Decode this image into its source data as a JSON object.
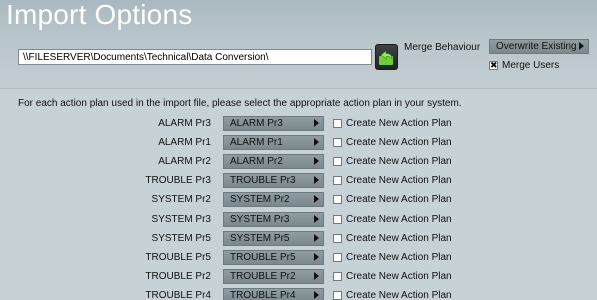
{
  "title": "Import Options",
  "path": {
    "value": "\\\\FILESERVER\\Documents\\Technical\\Data Conversion\\"
  },
  "browse_icon": "folder-refresh-icon",
  "merge": {
    "label": "Merge Behaviour",
    "selected": "Overwrite Existing",
    "merge_users_label": "Merge Users",
    "merge_users_checked": true,
    "merge_users_mark": "✖"
  },
  "instructions": "For each action plan used in the import file, please select the appropriate action plan in your system.",
  "create_label": "Create New Action Plan",
  "plans": [
    {
      "source": "ALARM Pr3",
      "target": "ALARM Pr3"
    },
    {
      "source": "ALARM Pr1",
      "target": "ALARM Pr1"
    },
    {
      "source": "ALARM Pr2",
      "target": "ALARM Pr2"
    },
    {
      "source": "TROUBLE Pr3",
      "target": "TROUBLE Pr3"
    },
    {
      "source": "SYSTEM Pr2",
      "target": "SYSTEM Pr2"
    },
    {
      "source": "SYSTEM Pr3",
      "target": "SYSTEM Pr3"
    },
    {
      "source": "SYSTEM Pr5",
      "target": "SYSTEM Pr5"
    },
    {
      "source": "TROUBLE Pr5",
      "target": "TROUBLE Pr5"
    },
    {
      "source": "TROUBLE Pr2",
      "target": "TROUBLE Pr2"
    },
    {
      "source": "TROUBLE Pr4",
      "target": "TROUBLE Pr4"
    }
  ],
  "colors": {
    "background": "#c7d2d7",
    "select": "#838f95",
    "browse_icon_green": "#6fcf3a"
  }
}
